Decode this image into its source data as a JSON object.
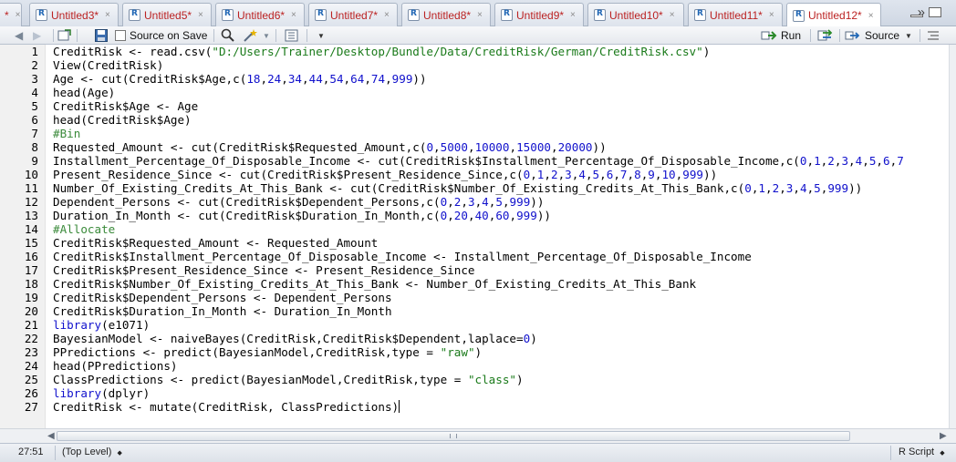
{
  "tabs": [
    {
      "label": "*",
      "active": false
    },
    {
      "label": "Untitled3*",
      "active": false
    },
    {
      "label": "Untitled5*",
      "active": false
    },
    {
      "label": "Untitled6*",
      "active": false
    },
    {
      "label": "Untitled7*",
      "active": false
    },
    {
      "label": "Untitled8*",
      "active": false
    },
    {
      "label": "Untitled9*",
      "active": false
    },
    {
      "label": "Untitled10*",
      "active": false
    },
    {
      "label": "Untitled11*",
      "active": false
    },
    {
      "label": "Untitled12*",
      "active": true
    }
  ],
  "tab_close_glyph": "×",
  "tab_overflow_glyph": "»",
  "toolbar": {
    "source_on_save_label": "Source on Save",
    "run_label": "Run",
    "source_label": "Source"
  },
  "editor": {
    "lines": [
      "CreditRisk <- read.csv(\"D:/Users/Trainer/Desktop/Bundle/Data/CreditRisk/German/CreditRisk.csv\")",
      "View(CreditRisk)",
      "Age <- cut(CreditRisk$Age,c(18,24,34,44,54,64,74,999))",
      "head(Age)",
      "CreditRisk$Age <- Age",
      "head(CreditRisk$Age)",
      "#Bin",
      "Requested_Amount <- cut(CreditRisk$Requested_Amount,c(0,5000,10000,15000,20000))",
      "Installment_Percentage_Of_Disposable_Income <- cut(CreditRisk$Installment_Percentage_Of_Disposable_Income,c(0,1,2,3,4,5,6,7",
      "Present_Residence_Since <- cut(CreditRisk$Present_Residence_Since,c(0,1,2,3,4,5,6,7,8,9,10,999))",
      "Number_Of_Existing_Credits_At_This_Bank <- cut(CreditRisk$Number_Of_Existing_Credits_At_This_Bank,c(0,1,2,3,4,5,999))",
      "Dependent_Persons <- cut(CreditRisk$Dependent_Persons,c(0,2,3,4,5,999))",
      "Duration_In_Month <- cut(CreditRisk$Duration_In_Month,c(0,20,40,60,999))",
      "#Allocate",
      "CreditRisk$Requested_Amount <- Requested_Amount",
      "CreditRisk$Installment_Percentage_Of_Disposable_Income <- Installment_Percentage_Of_Disposable_Income",
      "CreditRisk$Present_Residence_Since <- Present_Residence_Since",
      "CreditRisk$Number_Of_Existing_Credits_At_This_Bank <- Number_Of_Existing_Credits_At_This_Bank",
      "CreditRisk$Dependent_Persons <- Dependent_Persons",
      "CreditRisk$Duration_In_Month <- Duration_In_Month",
      "library(e1071)",
      "BayesianModel <- naiveBayes(CreditRisk,CreditRisk$Dependent,laplace=0)",
      "PPredictions <- predict(BayesianModel,CreditRisk,type = \"raw\")",
      "head(PPredictions)",
      "ClassPredictions <- predict(BayesianModel,CreditRisk,type = \"class\")",
      "library(dplyr)",
      "CreditRisk <- mutate(CreditRisk, ClassPredictions)"
    ],
    "cursor_line": 27
  },
  "status": {
    "position": "27:51",
    "scope": "(Top Level)",
    "language": "R Script"
  },
  "colors": {
    "tab_label": "#b22222",
    "keyword": "#1111cc",
    "string": "#1a7a1a",
    "comment": "#3a8a3a"
  }
}
